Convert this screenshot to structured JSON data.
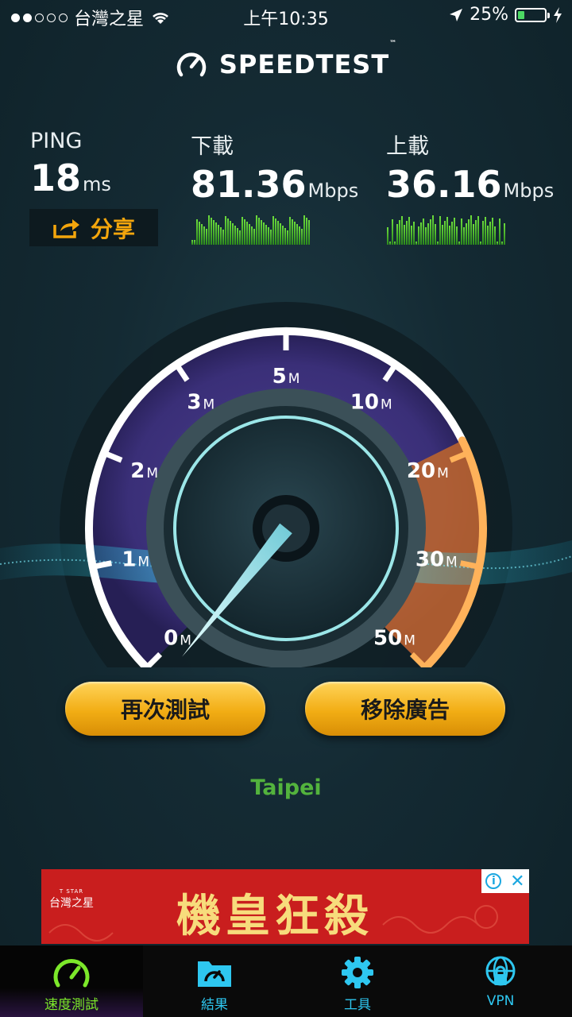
{
  "status_bar": {
    "carrier": "台灣之星",
    "time": "上午10:35",
    "battery_percent": "25%",
    "battery_level": 0.25,
    "signal_bars_filled": 2,
    "signal_bars_total": 5
  },
  "header": {
    "title": "SPEEDTEST",
    "trademark": "™"
  },
  "results": {
    "ping": {
      "label": "PING",
      "value": "18",
      "unit": "ms"
    },
    "download": {
      "label": "下載",
      "value": "81.36",
      "unit": "Mbps"
    },
    "upload": {
      "label": "上載",
      "value": "36.16",
      "unit": "Mbps"
    },
    "share_label": "分享"
  },
  "gauge": {
    "scale_labels": [
      {
        "num": "0",
        "unit": "M"
      },
      {
        "num": "1",
        "unit": "M"
      },
      {
        "num": "2",
        "unit": "M"
      },
      {
        "num": "3",
        "unit": "M"
      },
      {
        "num": "5",
        "unit": "M"
      },
      {
        "num": "10",
        "unit": "M"
      },
      {
        "num": "20",
        "unit": "M"
      },
      {
        "num": "30",
        "unit": "M"
      },
      {
        "num": "50",
        "unit": "M"
      }
    ],
    "needle_value_mbps": 0
  },
  "buttons": {
    "retest": "再次測試",
    "remove_ads": "移除廣告"
  },
  "server": "Taipei",
  "ad": {
    "brand": "台灣之星",
    "brand_small": "T STAR",
    "headline": "機皇狂殺",
    "info": "i",
    "close": "✕"
  },
  "tabs": [
    {
      "label": "速度測試",
      "icon": "speedometer-icon",
      "active": true
    },
    {
      "label": "結果",
      "icon": "results-folder-icon",
      "active": false
    },
    {
      "label": "工具",
      "icon": "gear-icon",
      "active": false
    },
    {
      "label": "VPN",
      "icon": "vpn-globe-lock-icon",
      "active": false
    }
  ],
  "colors": {
    "accent_orange": "#f4a60c",
    "accent_green": "#6bdc3c",
    "tab_blue": "#2ec7f0",
    "ad_red": "#c91e1e"
  }
}
